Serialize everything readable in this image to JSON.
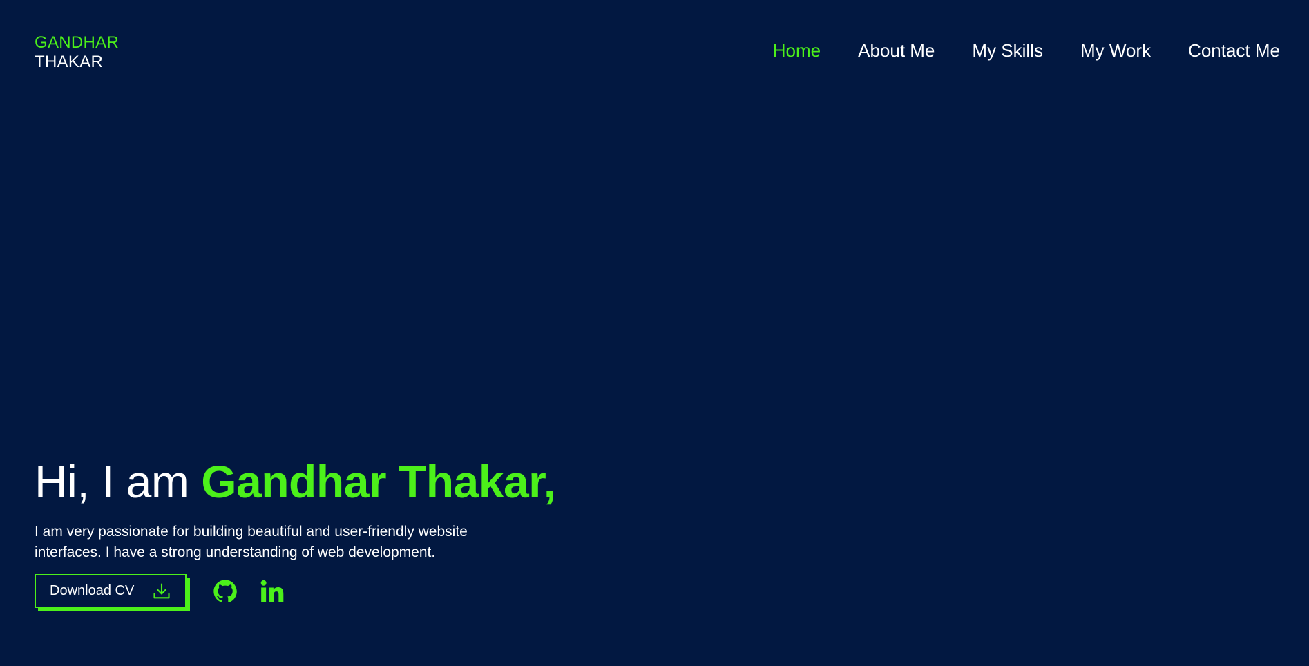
{
  "logo": {
    "first": "GANDHAR",
    "last": "THAKAR"
  },
  "nav": {
    "items": [
      {
        "label": "Home",
        "active": true
      },
      {
        "label": "About Me",
        "active": false
      },
      {
        "label": "My Skills",
        "active": false
      },
      {
        "label": "My Work",
        "active": false
      },
      {
        "label": "Contact Me",
        "active": false
      }
    ]
  },
  "hero": {
    "greeting": "Hi, I am ",
    "name": "Gandhar Thakar,",
    "description_line1": "I am very passionate for building beautiful and user-friendly website",
    "description_line2": "interfaces. I have a strong understanding of web development."
  },
  "actions": {
    "download_label": "Download CV",
    "download_icon": "download-icon",
    "social": [
      "github-icon",
      "linkedin-icon"
    ]
  },
  "colors": {
    "background": "#021841",
    "accent": "#4cf01a",
    "text": "#ffffff"
  }
}
